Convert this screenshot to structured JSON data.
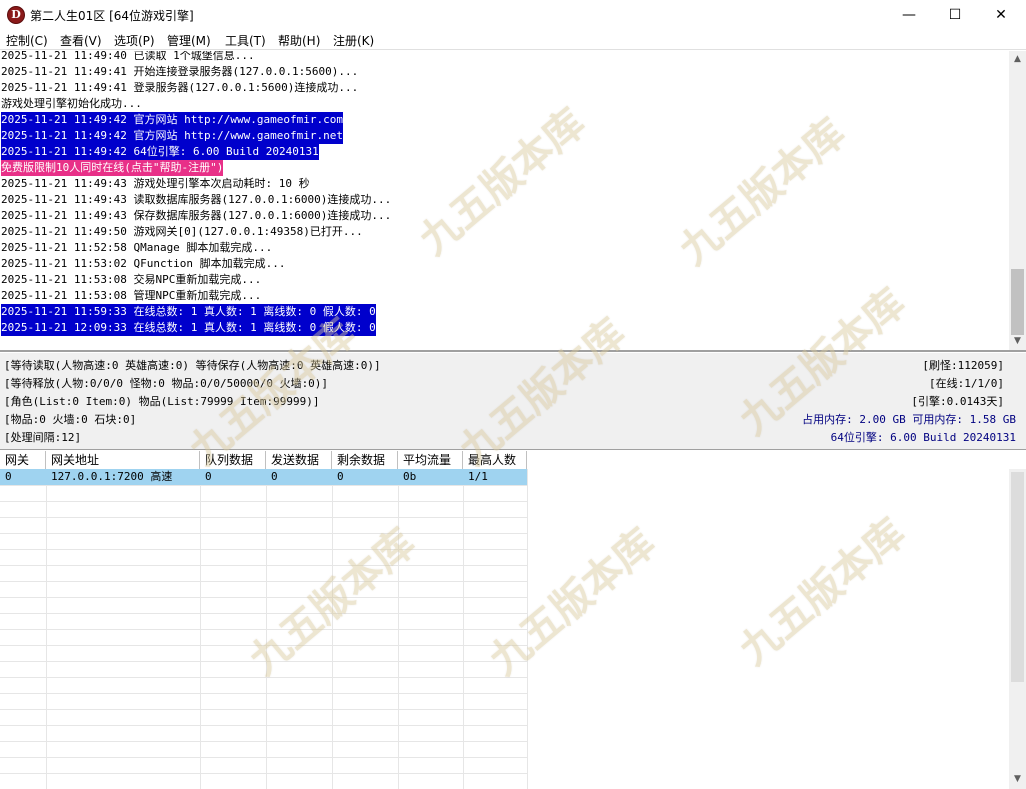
{
  "window": {
    "title": "第二人生01区 [64位游戏引擎]",
    "icon_letter": "D",
    "minimize": "—",
    "maximize": "☐",
    "close": "✕"
  },
  "menu": [
    "控制(C)",
    "查看(V)",
    "选项(P)",
    "管理(M)",
    "工具(T)",
    "帮助(H)",
    "注册(K)"
  ],
  "log": [
    {
      "text": "2025-11-21 11:49:40 已读取 1个城堡信息...",
      "style": "normal"
    },
    {
      "text": "2025-11-21 11:49:41 开始连接登录服务器(127.0.0.1:5600)...",
      "style": "normal"
    },
    {
      "text": "2025-11-21 11:49:41 登录服务器(127.0.0.1:5600)连接成功...",
      "style": "normal"
    },
    {
      "text": "游戏处理引擎初始化成功...",
      "style": "normal"
    },
    {
      "text": "2025-11-21 11:49:42 官方网站 http://www.gameofmir.com",
      "style": "sel"
    },
    {
      "text": "2025-11-21 11:49:42 官方网站 http://www.gameofmir.net",
      "style": "sel"
    },
    {
      "text": "2025-11-21 11:49:42 64位引擎: 6.00 Build 20240131",
      "style": "sel"
    },
    {
      "text": "免费版限制10人同时在线(点击\"帮助-注册\")",
      "style": "pink"
    },
    {
      "text": "2025-11-21 11:49:43 游戏处理引擎本次启动耗时: 10 秒",
      "style": "normal"
    },
    {
      "text": "2025-11-21 11:49:43 读取数据库服务器(127.0.0.1:6000)连接成功...",
      "style": "normal"
    },
    {
      "text": "2025-11-21 11:49:43 保存数据库服务器(127.0.0.1:6000)连接成功...",
      "style": "normal"
    },
    {
      "text": "2025-11-21 11:49:50 游戏网关[0](127.0.0.1:49358)已打开...",
      "style": "normal"
    },
    {
      "text": "2025-11-21 11:52:58 QManage 脚本加载完成...",
      "style": "normal"
    },
    {
      "text": "2025-11-21 11:53:02 QFunction 脚本加载完成...",
      "style": "normal"
    },
    {
      "text": "2025-11-21 11:53:08 交易NPC重新加载完成...",
      "style": "normal"
    },
    {
      "text": "2025-11-21 11:53:08 管理NPC重新加载完成...",
      "style": "normal"
    },
    {
      "text": "2025-11-21 11:59:33 在线总数: 1 真人数: 1 离线数: 0 假人数: 0",
      "style": "sel"
    },
    {
      "text": "2025-11-21 12:09:33 在线总数: 1 真人数: 1 离线数: 0 假人数: 0",
      "style": "sel"
    }
  ],
  "status": {
    "left": [
      "[等待读取(人物高速:0 英雄高速:0) 等待保存(人物高速:0 英雄高速:0)]",
      "[等待释放(人物:0/0/0 怪物:0 物品:0/0/50000/0 火墙:0)]",
      "[角色(List:0 Item:0) 物品(List:79999 Item:99999)]",
      "[物品:0 火墙:0 石块:0]",
      "[处理间隔:12]"
    ],
    "right": [
      "[刷怪:112059]",
      "[在线:1/1/0]",
      "[引擎:0.0143天]",
      "占用内存: 2.00 GB 可用内存: 1.58 GB",
      "64位引擎: 6.00 Build 20240131"
    ]
  },
  "grid": {
    "columns": [
      "网关",
      "网关地址",
      "队列数据",
      "发送数据",
      "剩余数据",
      "平均流量",
      "最高人数"
    ],
    "rows": [
      [
        "0",
        "127.0.0.1:7200 高速",
        "0",
        "0",
        "0",
        "0b",
        "1/1"
      ]
    ]
  },
  "watermark": {
    "text": "九五版本库",
    "url": "www.95bbk.com",
    "color": "#d8c89a"
  },
  "scroll_arrows": {
    "up": "▲",
    "down": "▼"
  }
}
